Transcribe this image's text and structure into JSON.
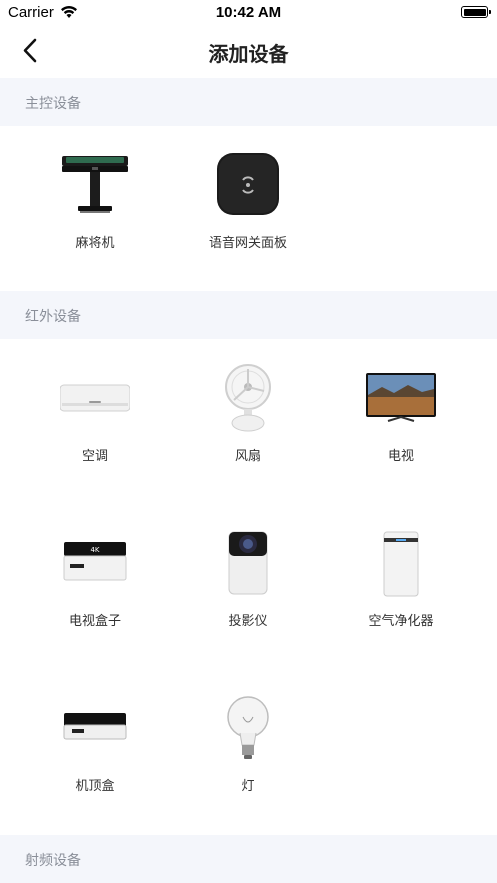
{
  "status_bar": {
    "carrier": "Carrier",
    "time": "10:42 AM"
  },
  "nav": {
    "title": "添加设备"
  },
  "sections": [
    {
      "title": "主控设备",
      "devices": [
        {
          "label": "麻将机"
        },
        {
          "label": "语音网关面板"
        }
      ]
    },
    {
      "title": "红外设备",
      "devices": [
        {
          "label": "空调"
        },
        {
          "label": "风扇"
        },
        {
          "label": "电视"
        },
        {
          "label": "电视盒子"
        },
        {
          "label": "投影仪"
        },
        {
          "label": "空气净化器"
        },
        {
          "label": "机顶盒"
        },
        {
          "label": "灯"
        }
      ]
    },
    {
      "title": "射频设备",
      "devices": []
    }
  ],
  "tv_box_badge": "4K",
  "colors": {
    "section_bg": "#f4f6fb",
    "section_text": "#8a8f99",
    "page_bg": "#ffffff"
  }
}
